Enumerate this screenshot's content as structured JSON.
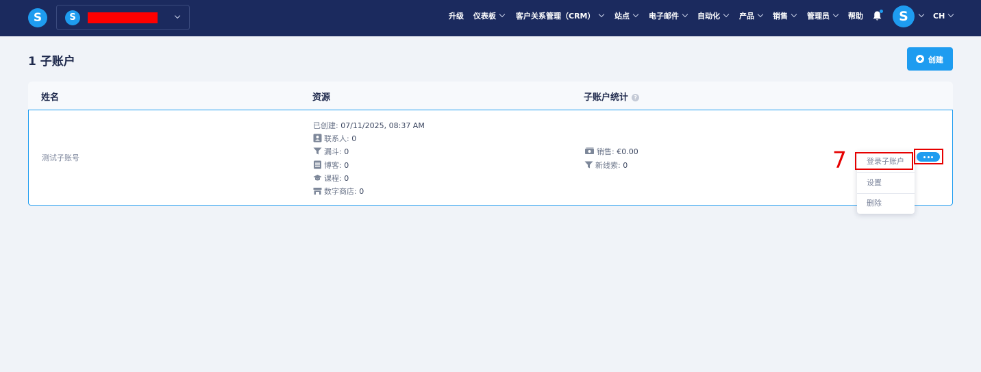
{
  "topbar": {
    "logo_letter": "S",
    "account_logo_letter": "S",
    "nav_items": [
      {
        "label": "升级",
        "has_dropdown": false
      },
      {
        "label": "仪表板",
        "has_dropdown": true
      },
      {
        "label": "客户关系管理（CRM）",
        "has_dropdown": true
      },
      {
        "label": "站点",
        "has_dropdown": true
      },
      {
        "label": "电子邮件",
        "has_dropdown": true
      },
      {
        "label": "自动化",
        "has_dropdown": true
      },
      {
        "label": "产品",
        "has_dropdown": true
      },
      {
        "label": "销售",
        "has_dropdown": true
      },
      {
        "label": "管理员",
        "has_dropdown": true
      },
      {
        "label": "帮助",
        "has_dropdown": false
      }
    ],
    "user_avatar_letter": "S",
    "language": "CH"
  },
  "page": {
    "title": "1 子账户",
    "create_label": "创建"
  },
  "table": {
    "headers": [
      "姓名",
      "资源",
      "子账户统计"
    ],
    "rows": [
      {
        "name": "测试子账号",
        "created_label": "已创建:",
        "created_value": "07/11/2025, 08:37 AM",
        "resources": [
          {
            "label": "联系人:",
            "value": "0",
            "icon": "contact-card-icon"
          },
          {
            "label": "漏斗:",
            "value": "0",
            "icon": "funnel-icon"
          },
          {
            "label": "博客:",
            "value": "0",
            "icon": "blog-document-icon"
          },
          {
            "label": "课程:",
            "value": "0",
            "icon": "graduation-cap-icon"
          },
          {
            "label": "数字商店:",
            "value": "0",
            "icon": "store-icon"
          }
        ],
        "stats": [
          {
            "label": "销售:",
            "value": "€0.00",
            "icon": "money-icon"
          },
          {
            "label": "新线索:",
            "value": "0",
            "icon": "funnel-icon"
          }
        ]
      }
    ]
  },
  "dropdown_menu": {
    "items": [
      "登录子账户",
      "设置",
      "删除"
    ]
  },
  "annotation": {
    "step_number": "7",
    "color": "#e60000"
  },
  "colors": {
    "topbar_bg": "#1b2a5e",
    "accent": "#1e9cf0",
    "page_bg": "#f0f3f8"
  }
}
